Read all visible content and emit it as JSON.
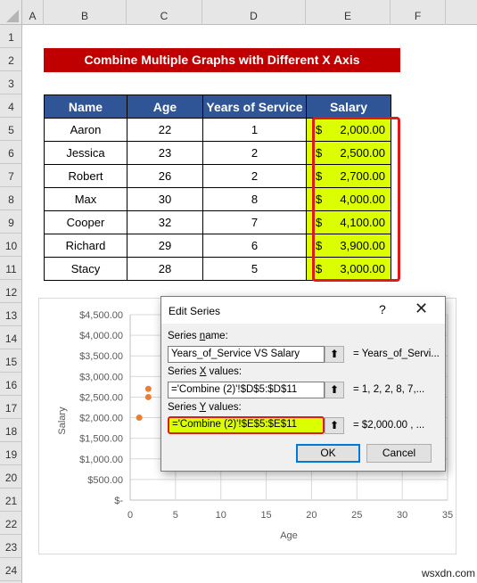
{
  "spreadsheet": {
    "columns": [
      "A",
      "B",
      "C",
      "D",
      "E",
      "F"
    ],
    "rows": [
      "1",
      "2",
      "3",
      "4",
      "5",
      "6",
      "7",
      "8",
      "9",
      "10",
      "11",
      "12",
      "13",
      "14",
      "15",
      "16",
      "17",
      "18",
      "19",
      "20",
      "21",
      "22",
      "23",
      "24"
    ],
    "title": "Combine Multiple Graphs with Different X Axis",
    "table": {
      "headers": [
        "Name",
        "Age",
        "Years of Service",
        "Salary"
      ],
      "rows": [
        {
          "name": "Aaron",
          "age": "22",
          "years": "1",
          "currency": "$",
          "salary": "2,000.00"
        },
        {
          "name": "Jessica",
          "age": "23",
          "years": "2",
          "currency": "$",
          "salary": "2,500.00"
        },
        {
          "name": "Robert",
          "age": "26",
          "years": "2",
          "currency": "$",
          "salary": "2,700.00"
        },
        {
          "name": "Max",
          "age": "30",
          "years": "8",
          "currency": "$",
          "salary": "4,000.00"
        },
        {
          "name": "Cooper",
          "age": "32",
          "years": "7",
          "currency": "$",
          "salary": "4,100.00"
        },
        {
          "name": "Richard",
          "age": "29",
          "years": "6",
          "currency": "$",
          "salary": "3,900.00"
        },
        {
          "name": "Stacy",
          "age": "28",
          "years": "5",
          "currency": "$",
          "salary": "3,000.00"
        }
      ]
    },
    "highlight_color": "#dcff00",
    "outline_color": "#e0191b",
    "header_color": "#2f5597",
    "title_color": "#c00000"
  },
  "chart_data": {
    "type": "scatter",
    "title": "",
    "xlabel": "Age",
    "ylabel": "Salary",
    "xlim": [
      0,
      35
    ],
    "ylim": [
      0,
      4500
    ],
    "x_ticks": [
      "0",
      "5",
      "10",
      "15",
      "20",
      "25",
      "30",
      "35"
    ],
    "y_ticks": [
      "$-",
      "$500.00",
      "$1,000.00",
      "$1,500.00",
      "$2,000.00",
      "$2,500.00",
      "$3,000.00",
      "$3,500.00",
      "$4,000.00",
      "$4,500.00"
    ],
    "grid": true,
    "marker_color": "#ed7d31",
    "series": [
      {
        "name": "Years_of_Service VS Salary",
        "x": [
          1,
          2,
          2
        ],
        "y": [
          2000,
          2500,
          2700
        ]
      }
    ]
  },
  "dialog": {
    "title": "Edit Series",
    "help": "?",
    "close": "✕",
    "series_name_label_pre": "Series ",
    "series_name_label_key": "n",
    "series_name_label_post": "ame:",
    "series_name_value": "Years_of_Service VS Salary",
    "series_name_preview": "= Years_of_Servi...",
    "x_label_pre": "Series ",
    "x_label_key": "X",
    "x_label_post": " values:",
    "x_value": "='Combine (2)'!$D$5:$D$11",
    "x_preview": "= 1, 2, 2, 8, 7,...",
    "y_label_pre": "Series ",
    "y_label_key": "Y",
    "y_label_post": " values:",
    "y_value": "='Combine (2)'!$E$5:$E$11",
    "y_preview": "=  $2,000.00 ,  ...",
    "collapse_glyph": "🠉",
    "ok_label": "OK",
    "cancel_label": "Cancel"
  },
  "watermark": "wsxdn.com"
}
